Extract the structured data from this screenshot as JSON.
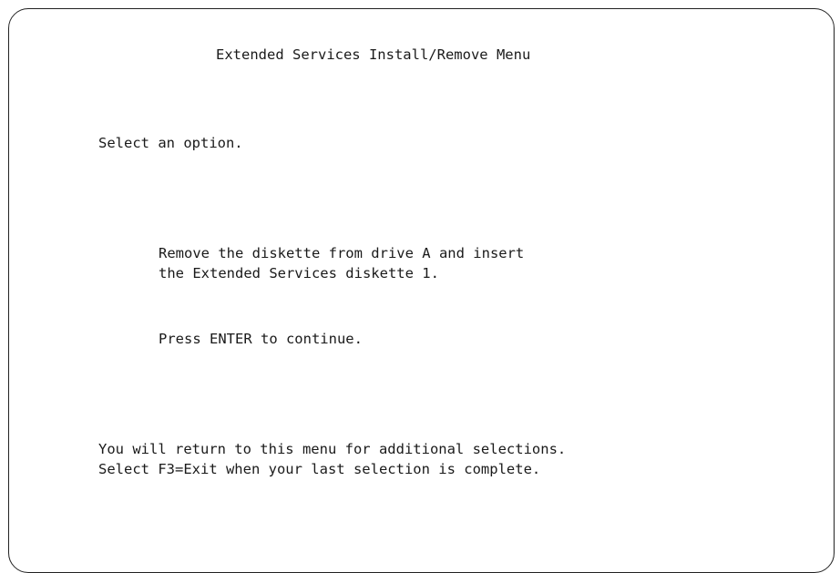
{
  "screen": {
    "title": "Extended Services Install/Remove Menu",
    "prompt": "Select an option.",
    "message": {
      "line1": "Remove the diskette from drive A and insert",
      "line2": "the Extended Services diskette 1."
    },
    "instruction": "Press ENTER to continue.",
    "footer": {
      "line1": "You will return to this menu for additional selections.",
      "line2": "Select F3=Exit when your last selection is complete."
    }
  }
}
